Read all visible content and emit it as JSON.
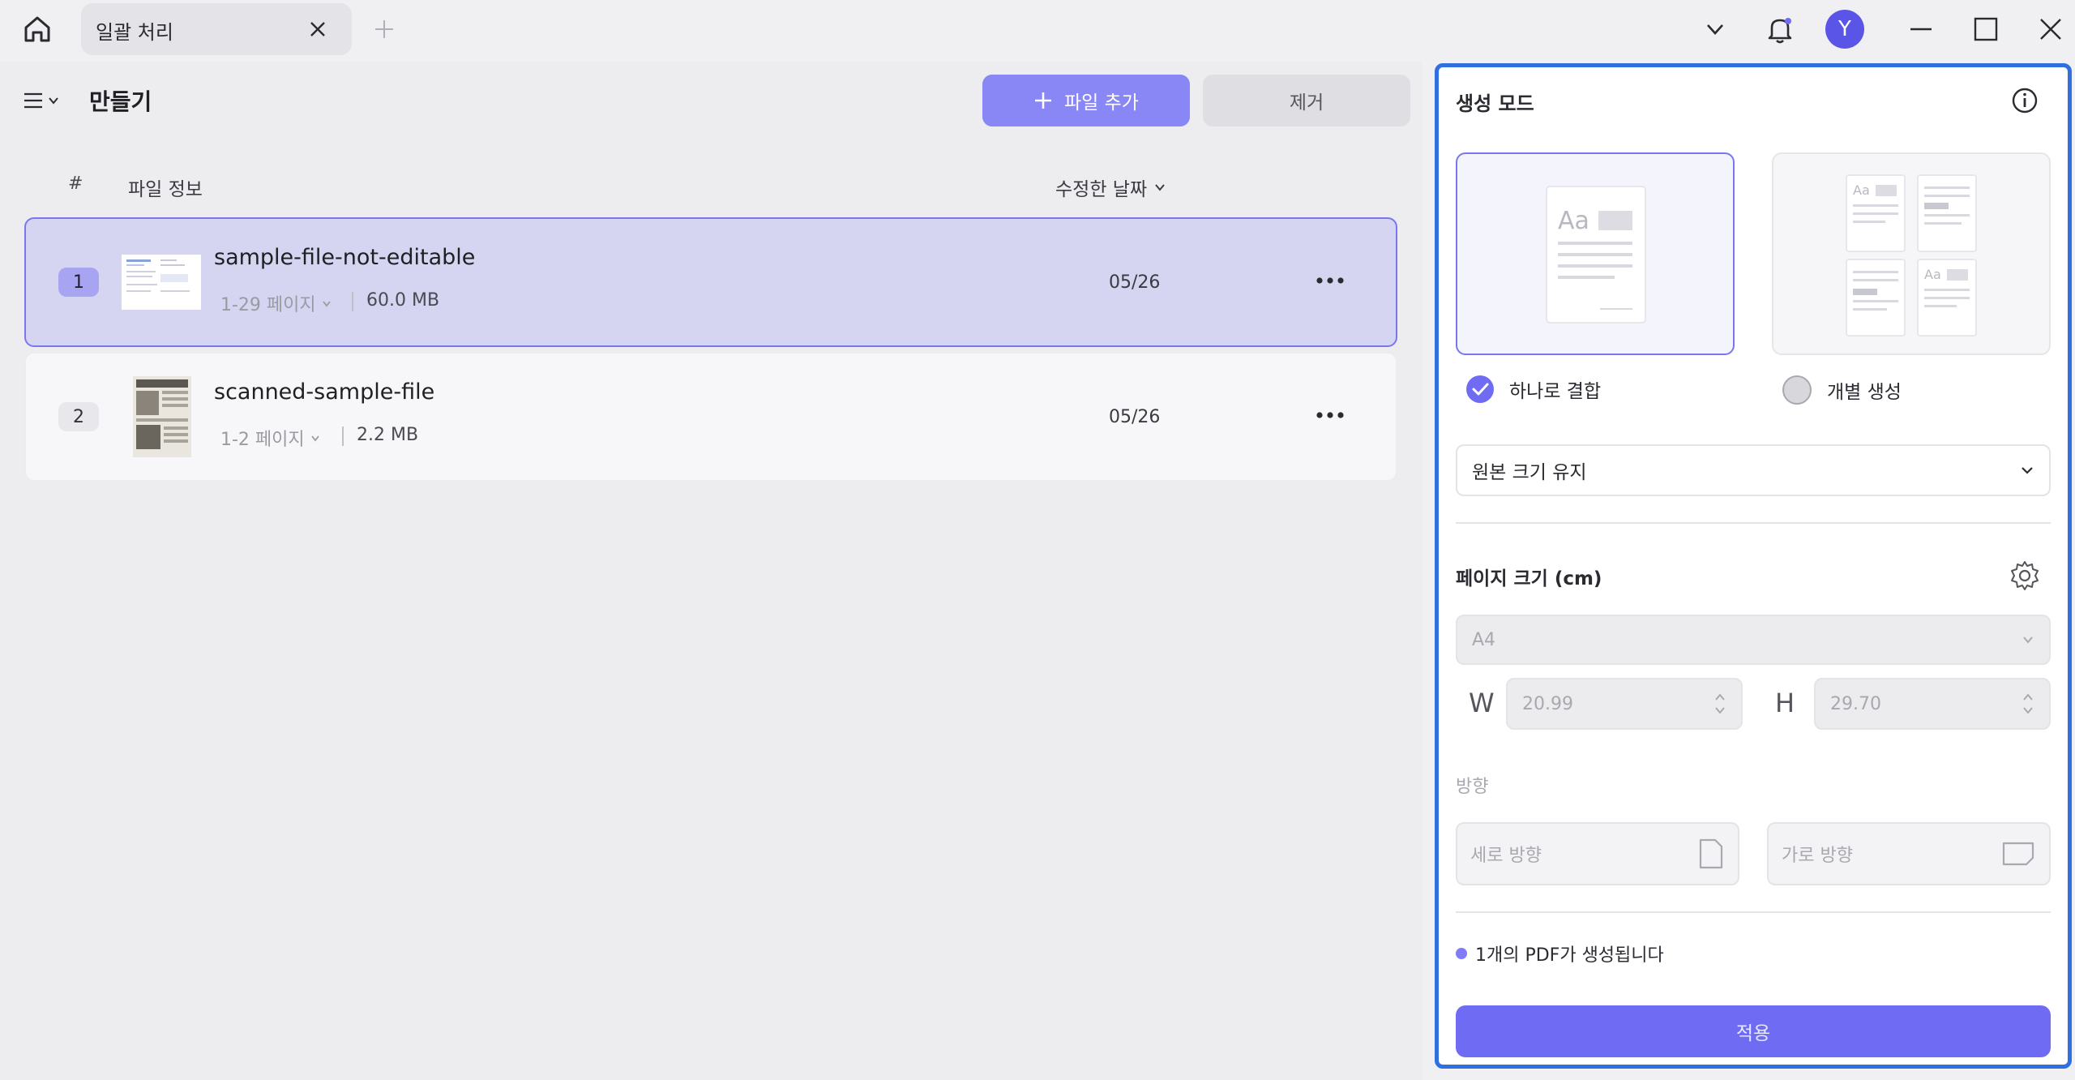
{
  "titlebar": {
    "tab_label": "일괄 처리",
    "avatar_letter": "Y"
  },
  "toolbar": {
    "title": "만들기",
    "add_file_label": "파일 추가",
    "remove_label": "제거"
  },
  "table": {
    "headers": {
      "index": "#",
      "file_info": "파일 정보",
      "modified": "수정한 날짜"
    },
    "rows": [
      {
        "index": "1",
        "name": "sample-file-not-editable",
        "pages": "1-29 페이지",
        "size": "60.0 MB",
        "date": "05/26",
        "selected": true
      },
      {
        "index": "2",
        "name": "scanned-sample-file",
        "pages": "1-2 페이지",
        "size": "2.2 MB",
        "date": "05/26",
        "selected": false
      }
    ]
  },
  "panel": {
    "mode_title": "생성 모드",
    "option_combine": "하나로 결합",
    "option_separate": "개별 생성",
    "combine_selected": true,
    "size_dropdown": "원본 크기 유지",
    "page_size_title": "페이지 크기 (cm)",
    "paper": "A4",
    "w_label": "W",
    "w_value": "20.99",
    "h_label": "H",
    "h_value": "29.70",
    "orientation_title": "방향",
    "portrait": "세로 방향",
    "landscape": "가로 방향",
    "status": "1개의 PDF가 생성됩니다",
    "apply": "적용"
  },
  "colors": {
    "accent": "#7a76f0",
    "apply": "#6f6cf3",
    "panel_border": "#2f6fe0",
    "selected_row": "#d5d5f1"
  }
}
